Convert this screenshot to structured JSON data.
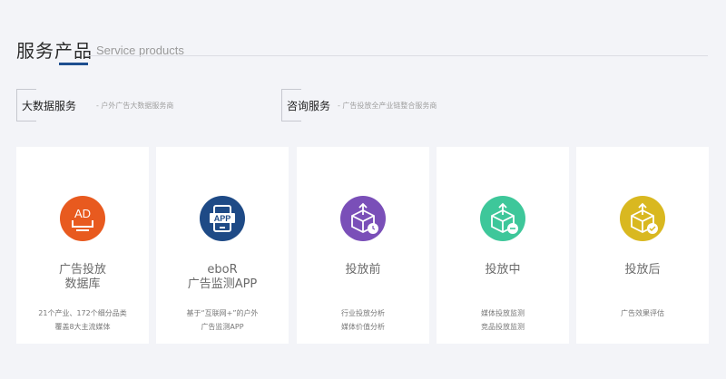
{
  "header": {
    "title_cn": "服务产品",
    "title_en": "Service products"
  },
  "categories": [
    {
      "name": "大数据服务",
      "desc": "- 户外广告大数据服务商"
    },
    {
      "name": "咨询服务",
      "desc": "- 广告投放全产业链整合服务商"
    }
  ],
  "cards": [
    {
      "title_lines": [
        "广告投放",
        "数据库"
      ],
      "desc_lines": [
        "21个产业、172个细分品类",
        "覆盖8大主流媒体"
      ],
      "icon": "ad-tray-icon",
      "color": "#e85a1f"
    },
    {
      "title_lines": [
        "eboR",
        "广告监测APP"
      ],
      "desc_lines": [
        "基于“互联网+”的户外",
        "广告监测APP"
      ],
      "icon": "app-phone-icon",
      "color": "#1e4a86"
    },
    {
      "title_lines": [
        "投放前"
      ],
      "desc_lines": [
        "行业投放分析",
        "媒体价值分析"
      ],
      "icon": "box-clock-icon",
      "color": "#7a4fb8"
    },
    {
      "title_lines": [
        "投放中"
      ],
      "desc_lines": [
        "媒体投放监测",
        "竞品投放监测"
      ],
      "icon": "box-minus-icon",
      "color": "#3ec79a"
    },
    {
      "title_lines": [
        "投放后"
      ],
      "desc_lines": [
        "广告效果评估"
      ],
      "icon": "box-check-icon",
      "color": "#d9b820"
    }
  ]
}
